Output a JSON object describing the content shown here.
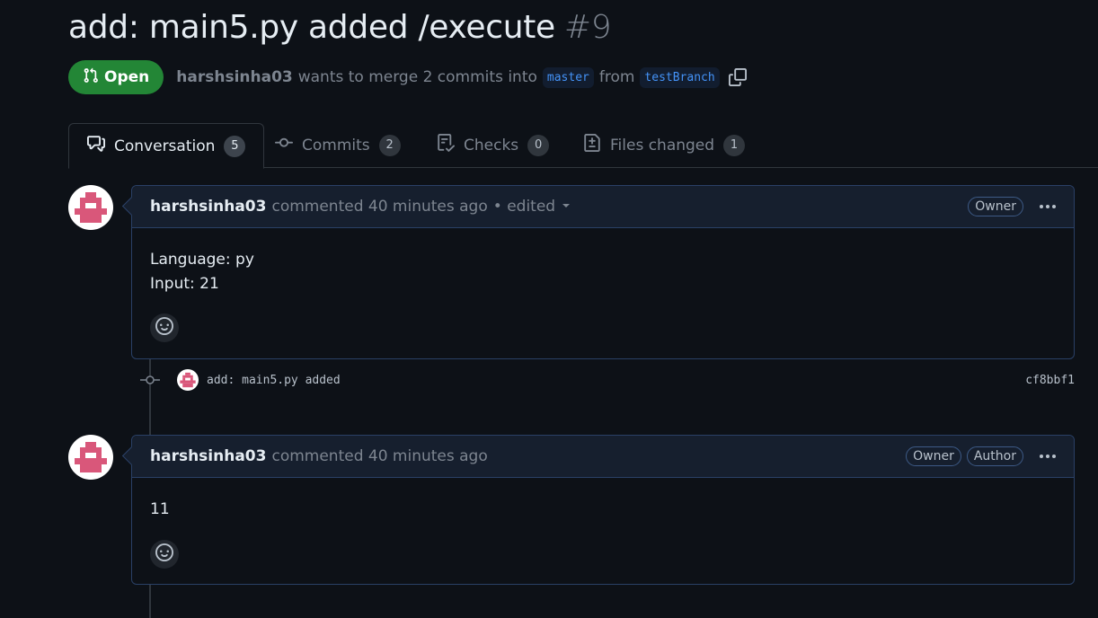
{
  "pr": {
    "title": "add: main5.py added /execute",
    "number": "#9",
    "state": "Open",
    "author": "harshsinha03",
    "merge_text": "wants to merge 2 commits into",
    "base_branch": "master",
    "from_text": "from",
    "head_branch": "testBranch"
  },
  "tabs": [
    {
      "label": "Conversation",
      "count": "5",
      "icon": "conversation-icon"
    },
    {
      "label": "Commits",
      "count": "2",
      "icon": "commit-icon"
    },
    {
      "label": "Checks",
      "count": "0",
      "icon": "checklist-icon"
    },
    {
      "label": "Files changed",
      "count": "1",
      "icon": "diff-icon"
    }
  ],
  "comments": [
    {
      "author": "harshsinha03",
      "action": "commented 40 minutes ago",
      "edited": "• edited",
      "roles": [
        "Owner"
      ],
      "lines": [
        "Language: py",
        "Input: 21"
      ]
    },
    {
      "author": "harshsinha03",
      "action": "commented 40 minutes ago",
      "roles": [
        "Owner",
        "Author"
      ],
      "lines": [
        "11"
      ]
    }
  ],
  "commit": {
    "message": "add: main5.py added",
    "sha": "cf8bbf1"
  },
  "colors": {
    "background": "#0d1117",
    "open_green": "#238636",
    "link_blue": "#4493f8",
    "avatar_pink": "#d9577a"
  }
}
